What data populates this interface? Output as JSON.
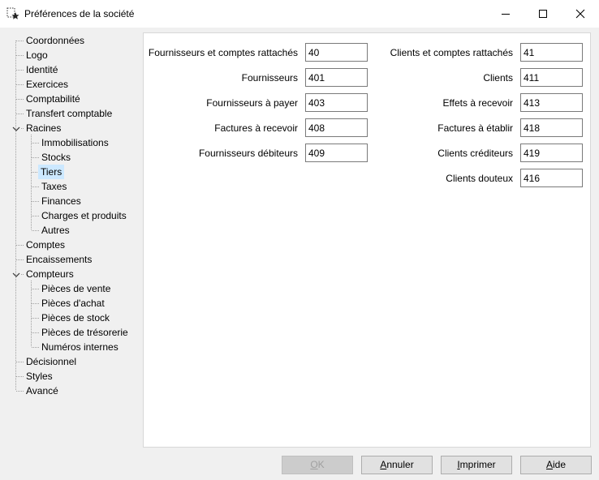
{
  "window": {
    "title": "Préférences de la société"
  },
  "tree": {
    "items": [
      {
        "label": "Coordonnées"
      },
      {
        "label": "Logo"
      },
      {
        "label": "Identité"
      },
      {
        "label": "Exercices"
      },
      {
        "label": "Comptabilité"
      },
      {
        "label": "Transfert comptable"
      },
      {
        "label": "Racines",
        "expanded": true
      },
      {
        "label": "Immobilisations"
      },
      {
        "label": "Stocks"
      },
      {
        "label": "Tiers",
        "selected": true
      },
      {
        "label": "Taxes"
      },
      {
        "label": "Finances"
      },
      {
        "label": "Charges et produits"
      },
      {
        "label": "Autres"
      },
      {
        "label": "Comptes"
      },
      {
        "label": "Encaissements"
      },
      {
        "label": "Compteurs",
        "expanded": true
      },
      {
        "label": "Pièces de vente"
      },
      {
        "label": "Pièces d'achat"
      },
      {
        "label": "Pièces de stock"
      },
      {
        "label": "Pièces de trésorerie"
      },
      {
        "label": "Numéros internes"
      },
      {
        "label": "Décisionnel"
      },
      {
        "label": "Styles"
      },
      {
        "label": "Avancé"
      }
    ]
  },
  "fournisseurs": [
    {
      "label": "Fournisseurs et comptes rattachés",
      "value": "40"
    },
    {
      "label": "Fournisseurs",
      "value": "401"
    },
    {
      "label": "Fournisseurs à payer",
      "value": "403"
    },
    {
      "label": "Factures à recevoir",
      "value": "408"
    },
    {
      "label": "Fournisseurs débiteurs",
      "value": "409"
    }
  ],
  "clients": [
    {
      "label": "Clients et comptes rattachés",
      "value": "41"
    },
    {
      "label": "Clients",
      "value": "411"
    },
    {
      "label": "Effets à recevoir",
      "value": "413"
    },
    {
      "label": "Factures à établir",
      "value": "418"
    },
    {
      "label": "Clients créditeurs",
      "value": "419"
    },
    {
      "label": "Clients douteux",
      "value": "416"
    }
  ],
  "buttons": {
    "ok": {
      "first": "O",
      "rest": "K"
    },
    "annuler": {
      "first": "A",
      "rest": "nnuler"
    },
    "imprimer": {
      "first": "I",
      "rest": "mprimer"
    },
    "aide": {
      "first": "A",
      "rest": "ide"
    }
  }
}
